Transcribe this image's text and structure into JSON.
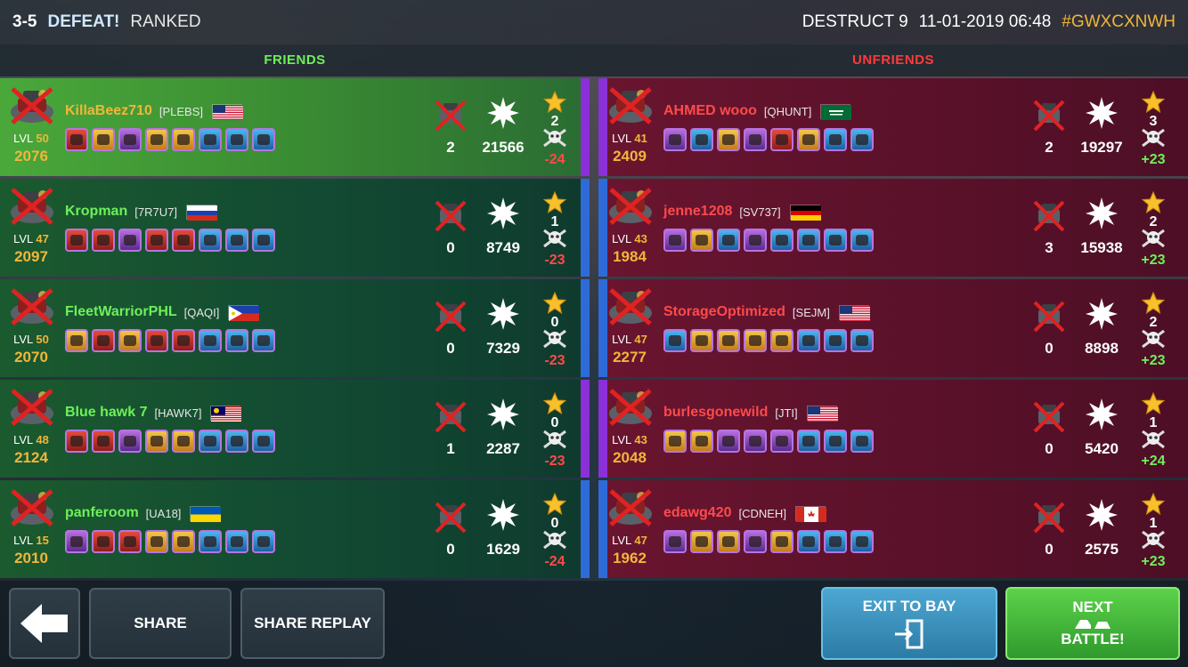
{
  "header": {
    "score": "3-5",
    "result": "DEFEAT!",
    "mode": "RANKED",
    "map": "DESTRUCT 9",
    "datetime": "11-01-2019 06:48",
    "battle_code": "#GWXCXNWH"
  },
  "teams": {
    "friends_title": "FRIENDS",
    "unfriends_title": "UNFRIENDS"
  },
  "friends": [
    {
      "name": "KillaBeez710",
      "clan": "[PLEBS]",
      "flag": "us",
      "lvl_label": "LVL",
      "lvl": "50",
      "rating": "2076",
      "kills": "2",
      "damage": "21566",
      "stars": "2",
      "delta": "-24",
      "self": true,
      "bar": "purple",
      "weapons": [
        "red",
        "gold",
        "purple",
        "gold",
        "gold",
        "blue",
        "blue",
        "blue"
      ]
    },
    {
      "name": "Kropman",
      "clan": "[7R7U7]",
      "flag": "ru",
      "lvl_label": "LVL",
      "lvl": "47",
      "rating": "2097",
      "kills": "0",
      "damage": "8749",
      "stars": "1",
      "delta": "-23",
      "self": false,
      "bar": "blue",
      "weapons": [
        "red",
        "red",
        "purple",
        "red",
        "red",
        "blue",
        "blue",
        "blue"
      ]
    },
    {
      "name": "FleetWarriorPHL",
      "clan": "[QAQI]",
      "flag": "ph",
      "lvl_label": "LVL",
      "lvl": "50",
      "rating": "2070",
      "kills": "0",
      "damage": "7329",
      "stars": "0",
      "delta": "-23",
      "self": false,
      "bar": "blue",
      "weapons": [
        "gold",
        "red",
        "gold",
        "red",
        "red",
        "blue",
        "blue",
        "blue"
      ]
    },
    {
      "name": "Blue hawk 7",
      "clan": "[HAWK7]",
      "flag": "my",
      "lvl_label": "LVL",
      "lvl": "48",
      "rating": "2124",
      "kills": "1",
      "damage": "2287",
      "stars": "0",
      "delta": "-23",
      "self": false,
      "bar": "purple",
      "weapons": [
        "red",
        "red",
        "purple",
        "gold",
        "gold",
        "blue",
        "blue",
        "blue"
      ]
    },
    {
      "name": "panferoom",
      "clan": "[UA18]",
      "flag": "ua",
      "lvl_label": "LVL",
      "lvl": "15",
      "rating": "2010",
      "kills": "0",
      "damage": "1629",
      "stars": "0",
      "delta": "-24",
      "self": false,
      "bar": "blue",
      "weapons": [
        "purple",
        "red",
        "red",
        "gold",
        "gold",
        "blue",
        "blue",
        "blue"
      ]
    }
  ],
  "unfriends": [
    {
      "name": "AHMED wooo",
      "clan": "[QHUNT]",
      "flag": "sa",
      "lvl_label": "LVL",
      "lvl": "41",
      "rating": "2409",
      "kills": "2",
      "damage": "19297",
      "stars": "3",
      "delta": "+23",
      "bar": "purple",
      "weapons": [
        "purple",
        "blue",
        "gold",
        "purple",
        "red",
        "gold",
        "blue",
        "blue"
      ]
    },
    {
      "name": "jenne1208",
      "clan": "[SV737]",
      "flag": "de",
      "lvl_label": "LVL",
      "lvl": "43",
      "rating": "1984",
      "kills": "3",
      "damage": "15938",
      "stars": "2",
      "delta": "+23",
      "bar": "blue",
      "weapons": [
        "purple",
        "gold",
        "blue",
        "purple",
        "blue",
        "blue",
        "blue",
        "blue"
      ]
    },
    {
      "name": "StorageOptimized",
      "clan": "[SEJM]",
      "flag": "us",
      "lvl_label": "LVL",
      "lvl": "47",
      "rating": "2277",
      "kills": "0",
      "damage": "8898",
      "stars": "2",
      "delta": "+23",
      "bar": "blue",
      "weapons": [
        "blue",
        "gold",
        "gold",
        "gold",
        "gold",
        "blue",
        "blue",
        "blue"
      ]
    },
    {
      "name": "burlesgonewild",
      "clan": "[JTI]",
      "flag": "us",
      "lvl_label": "LVL",
      "lvl": "43",
      "rating": "2048",
      "kills": "0",
      "damage": "5420",
      "stars": "1",
      "delta": "+24",
      "bar": "purple",
      "weapons": [
        "gold",
        "gold",
        "purple",
        "purple",
        "purple",
        "blue",
        "blue",
        "blue"
      ]
    },
    {
      "name": "edawg420",
      "clan": "[CDNEH]",
      "flag": "ca",
      "lvl_label": "LVL",
      "lvl": "47",
      "rating": "1962",
      "kills": "0",
      "damage": "2575",
      "stars": "1",
      "delta": "+23",
      "bar": "blue",
      "weapons": [
        "purple",
        "gold",
        "gold",
        "purple",
        "gold",
        "blue",
        "blue",
        "blue"
      ]
    }
  ],
  "buttons": {
    "back_icon": "arrow-left-icon",
    "share": "SHARE",
    "share_replay": "SHARE REPLAY",
    "exit_to_bay": "EXIT TO BAY",
    "exit_icon": "door-exit-icon",
    "next_battle_line1": "NEXT",
    "next_battle_line2": "BATTLE!"
  },
  "colors": {
    "friend_name": "#6ef05a",
    "self_name": "#f1b63a",
    "enemy_name": "#ff4a4a",
    "accent_gold": "#f1b63a"
  }
}
